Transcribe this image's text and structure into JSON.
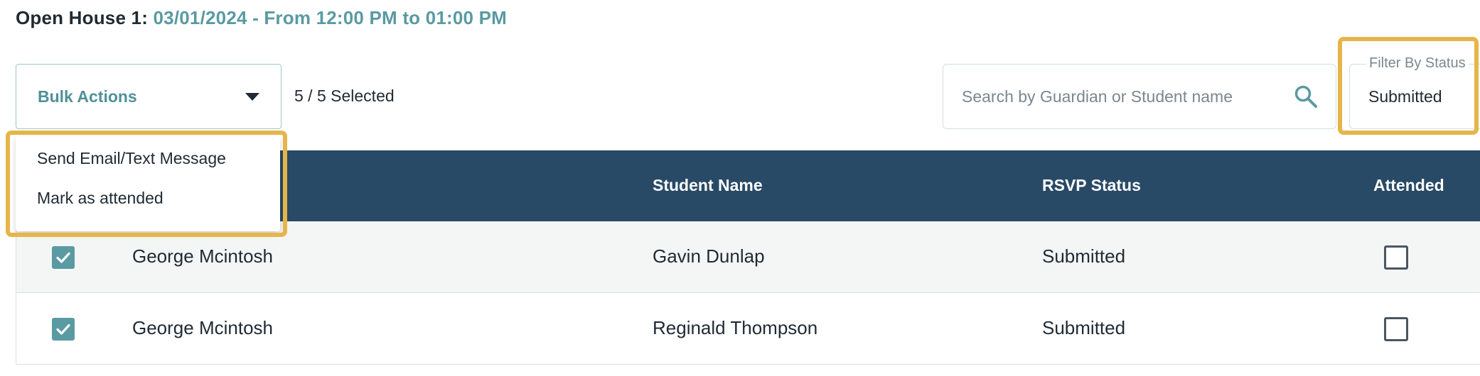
{
  "heading": {
    "label": "Open House 1:",
    "value": "03/01/2024 - From 12:00 PM to 01:00 PM"
  },
  "toolbar": {
    "bulk_actions_label": "Bulk Actions",
    "selected_count": "5 / 5 Selected",
    "search_placeholder": "Search by Guardian or Student name",
    "search_value": "",
    "filter_label": "Filter By Status",
    "filter_value": "Submitted"
  },
  "bulk_menu": {
    "items": [
      {
        "label": "Send Email/Text Message"
      },
      {
        "label": "Mark as attended"
      }
    ]
  },
  "table": {
    "columns": {
      "student_name": "Student Name",
      "rsvp_status": "RSVP Status",
      "attended": "Attended"
    },
    "rows": [
      {
        "guardian": "George Mcintosh",
        "student": "Gavin Dunlap",
        "rsvp": "Submitted",
        "selected": true,
        "attended": false
      },
      {
        "guardian": "George Mcintosh",
        "student": "Reginald Thompson",
        "rsvp": "Submitted",
        "selected": true,
        "attended": false
      }
    ]
  },
  "colors": {
    "accent": "#5a9aa2",
    "header_bg": "#284a66",
    "highlight": "#e6b54a"
  }
}
